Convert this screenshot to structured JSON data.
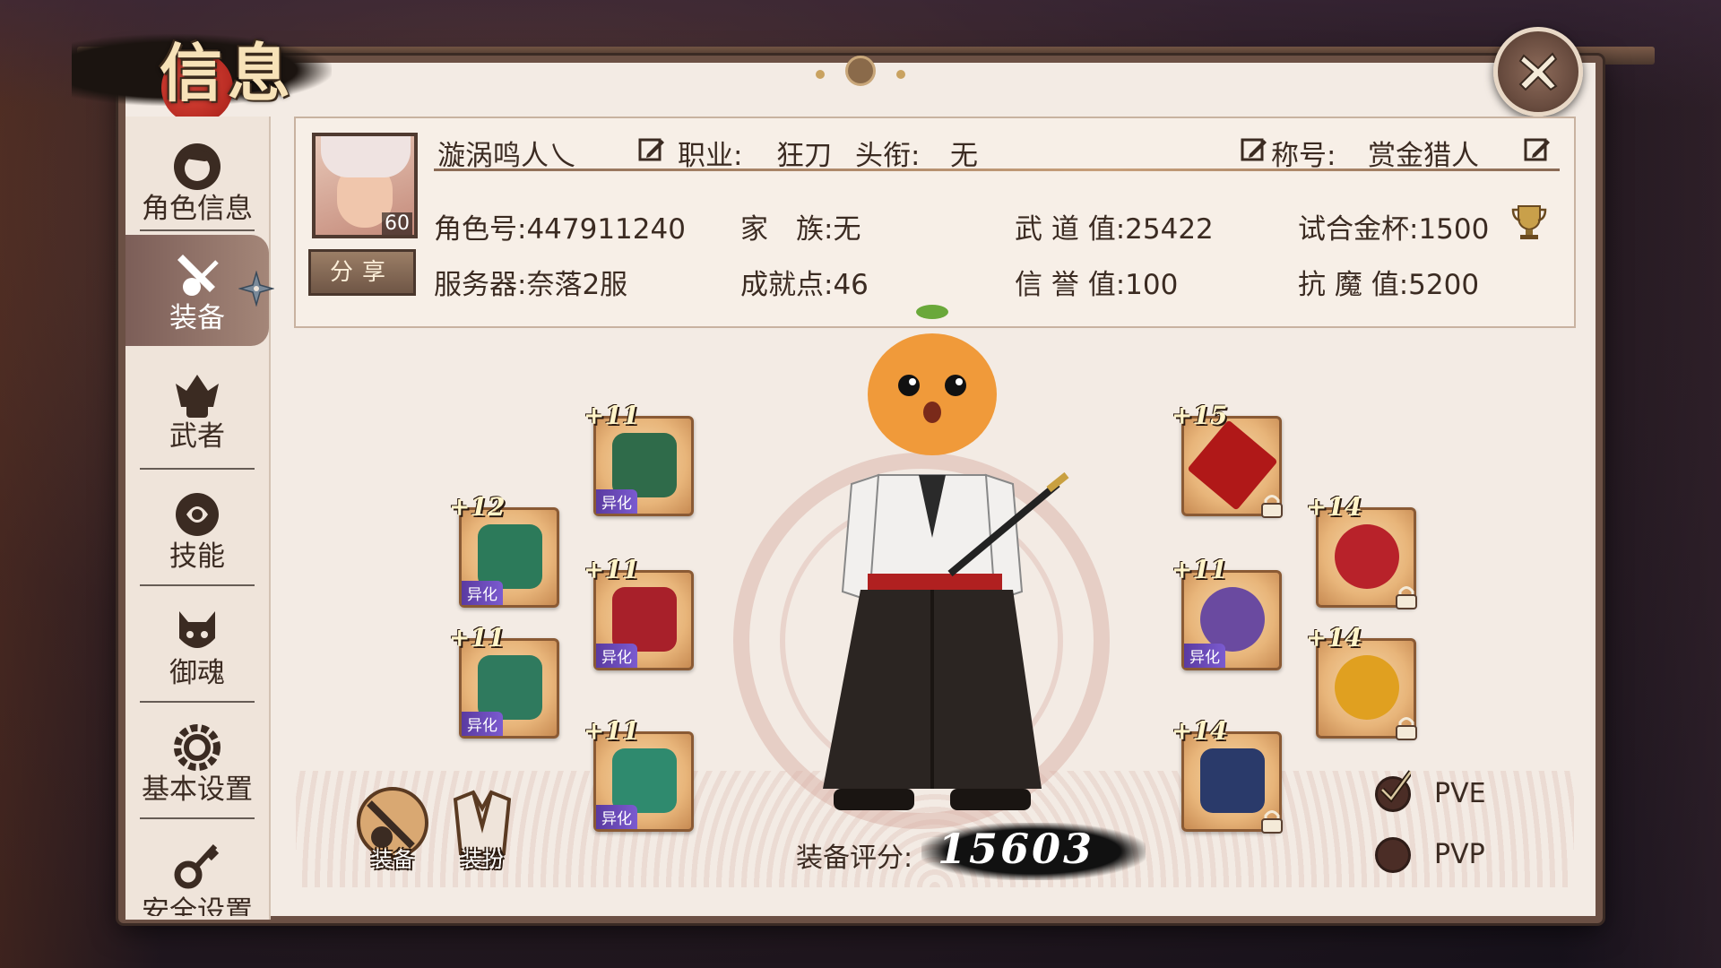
{
  "window": {
    "title": "信息",
    "close_icon": "close-icon"
  },
  "sidebar": {
    "items": [
      {
        "label": "角色信息",
        "icon": "character-icon"
      },
      {
        "label": "装备",
        "icon": "equipment-icon",
        "active": true
      },
      {
        "label": "武者",
        "icon": "samurai-icon"
      },
      {
        "label": "技能",
        "icon": "skill-icon"
      },
      {
        "label": "御魂",
        "icon": "soul-icon"
      },
      {
        "label": "基本设置",
        "icon": "settings-gear-icon"
      },
      {
        "label": "安全设置",
        "icon": "key-icon"
      }
    ]
  },
  "profile": {
    "name": "漩涡鸣人乀",
    "job_label": "职业:",
    "job_value": "狂刀",
    "rank_label": "头衔:",
    "rank_value": "无",
    "title_label": "称号:",
    "title_value": "赏金猎人",
    "level": "60",
    "share_label": "分享"
  },
  "stats": {
    "role_id": "角色号:447911240",
    "family": "家　族:无",
    "wudao": "武 道 值:25422",
    "cup": "试合金杯:1500",
    "server": "服务器:奈落2服",
    "achievement": "成就点:46",
    "reputation": "信 誉 值:100",
    "resist": "抗 魔 值:5200"
  },
  "equipment": {
    "left": [
      {
        "plus": "+11",
        "tag": "异化",
        "color": "#2f6b4a"
      },
      {
        "plus": "+12",
        "tag": "异化",
        "color": "#2c7a5a"
      },
      {
        "plus": "+11",
        "tag": "异化",
        "color": "#a8202a"
      },
      {
        "plus": "+11",
        "tag": "异化",
        "color": "#2f7a5e"
      },
      {
        "plus": "+11",
        "tag": "异化",
        "color": "#2f8a6e"
      }
    ],
    "right": [
      {
        "plus": "+15",
        "tag": "",
        "color": "#b01818",
        "locked": true
      },
      {
        "plus": "+14",
        "tag": "",
        "color": "#b8222a",
        "locked": true
      },
      {
        "plus": "+11",
        "tag": "异化",
        "color": "#6a4aa0",
        "locked": false
      },
      {
        "plus": "+14",
        "tag": "",
        "color": "#e0a020",
        "locked": true
      },
      {
        "plus": "+14",
        "tag": "",
        "color": "#2a3a6a",
        "locked": true
      }
    ],
    "score_label": "装备评分:",
    "score_value": "15603"
  },
  "modes": {
    "equip": "装备",
    "dress": "装扮"
  },
  "battle": {
    "pve": "PVE",
    "pvp": "PVP",
    "selected": "PVE"
  }
}
